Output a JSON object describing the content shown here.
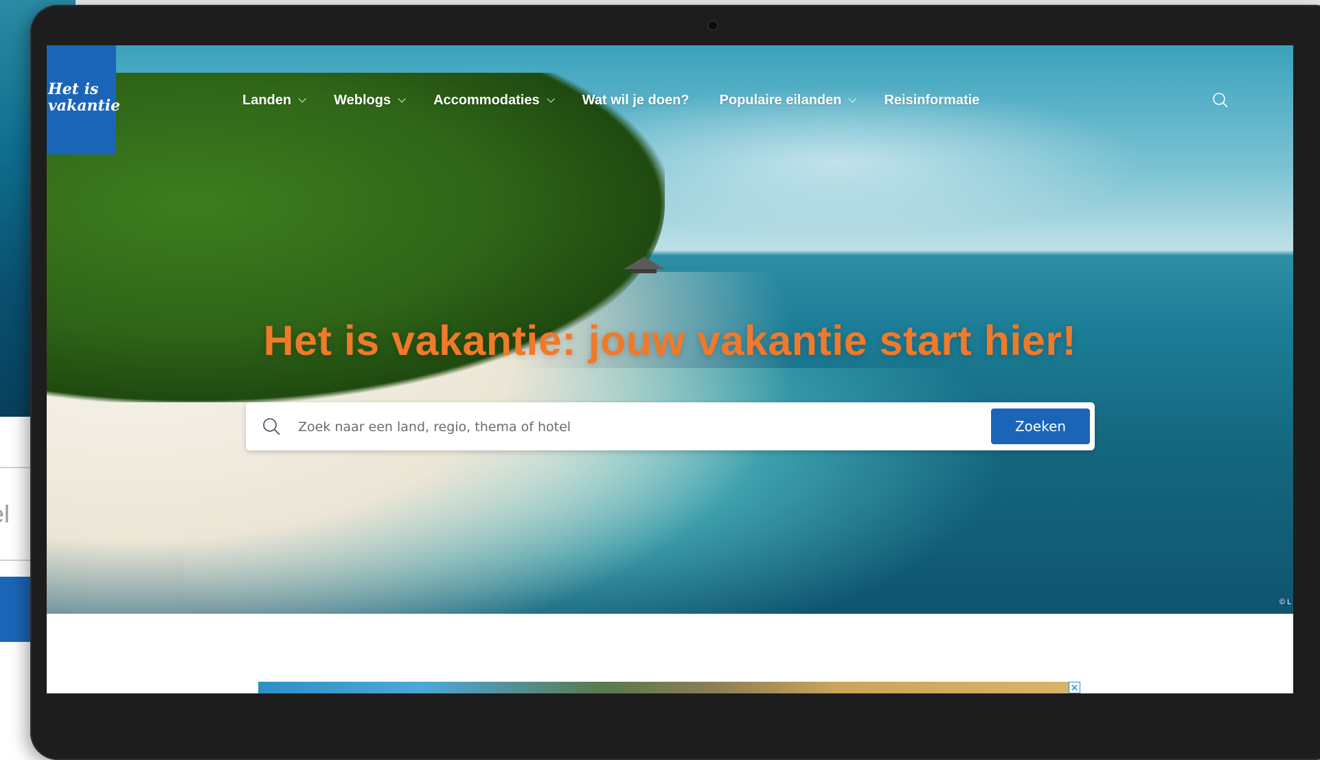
{
  "background": {
    "input_fragment": "el"
  },
  "site": {
    "logo_line1": "Het is",
    "logo_line2": "vakantie"
  },
  "nav": {
    "items": [
      {
        "label": "Landen",
        "dropdown": true
      },
      {
        "label": "Weblogs",
        "dropdown": true
      },
      {
        "label": "Accommodaties",
        "dropdown": true
      },
      {
        "label": "Wat wil je doen?",
        "dropdown": false
      },
      {
        "label": "Populaire eilanden",
        "dropdown": true
      },
      {
        "label": "Reisinformatie",
        "dropdown": false
      }
    ],
    "search_icon": "search-icon"
  },
  "hero": {
    "headline": "Het is vakantie: jouw vakantie start hier!",
    "copyright": "© L"
  },
  "search": {
    "placeholder": "Zoek naar een land, regio, thema of hotel",
    "button_label": "Zoeken"
  },
  "ad": {
    "close_label": "✕"
  },
  "colors": {
    "brand_blue": "#1b65b8",
    "headline_orange": "#f07a2a"
  }
}
